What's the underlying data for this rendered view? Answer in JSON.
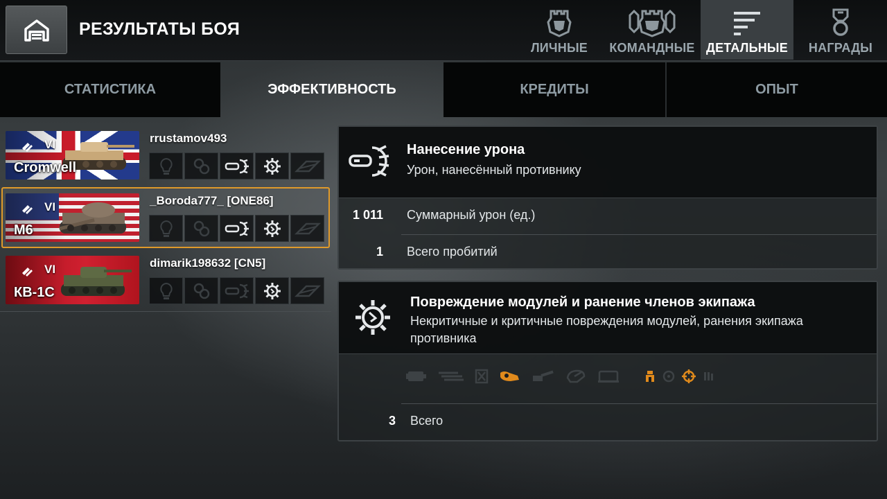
{
  "header": {
    "title": "РЕЗУЛЬТАТЫ БОЯ",
    "tabs": [
      {
        "label": "ЛИЧНЫЕ",
        "icon": "personal-shield-icon"
      },
      {
        "label": "КОМАНДНЫЕ",
        "icon": "team-shields-icon"
      },
      {
        "label": "ДЕТАЛЬНЫЕ",
        "icon": "detail-lines-icon",
        "active": true
      },
      {
        "label": "НАГРАДЫ",
        "icon": "medal-icon"
      }
    ]
  },
  "subtabs": [
    {
      "label": "СТАТИСТИКА"
    },
    {
      "label": "ЭФФЕКТИВНОСТЬ",
      "active": true
    },
    {
      "label": "КРЕДИТЫ"
    },
    {
      "label": "ОПЫТ"
    }
  ],
  "players": [
    {
      "tier": "VI",
      "tank": "Cromwell",
      "nation": "uk",
      "name": "rrustamov493"
    },
    {
      "tier": "VI",
      "tank": "M6",
      "nation": "usa",
      "name": "_Boroda777_ [ONE86]",
      "selected": true
    },
    {
      "tier": "VI",
      "tank": "КВ-1С",
      "nation": "ussr",
      "name": "dimarik198632 [CN5]"
    }
  ],
  "damage_panel": {
    "title": "Нанесение урона",
    "subtitle": "Урон, нанесённый противнику",
    "rows": [
      {
        "value": "1 011",
        "label": "Суммарный урон (ед.)"
      },
      {
        "value": "1",
        "label": "Всего пробитий"
      }
    ]
  },
  "modules_panel": {
    "title": "Повреждение модулей и ранение членов экипажа",
    "subtitle_line1": "Некритичные и критичные повреждения модулей, ранения экипажа",
    "subtitle_line2": "противника",
    "total_value": "3",
    "total_label": "Всего"
  },
  "colors": {
    "accent_orange": "#e09a2a",
    "active_tab_bg": "#3a3f42",
    "inactive_text": "#9aa6ad"
  }
}
